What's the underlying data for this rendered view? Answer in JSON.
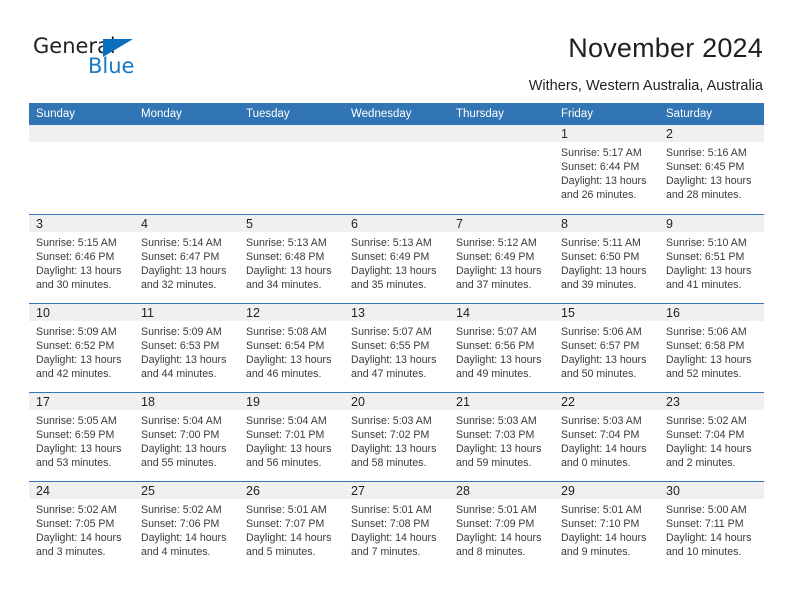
{
  "logo": {
    "word_top": "General",
    "word_bottom": "Blue",
    "triangle_color": "#0b6fc0",
    "blue_text_color": "#1878c4"
  },
  "header": {
    "title": "November 2024",
    "subtitle": "Withers, Western Australia, Australia"
  },
  "colors": {
    "header_blue": "#3175b4",
    "day_band_gray": "#f0f0f0",
    "text": "#231f20"
  },
  "calendar": {
    "weekday_headers": [
      "Sunday",
      "Monday",
      "Tuesday",
      "Wednesday",
      "Thursday",
      "Friday",
      "Saturday"
    ],
    "weeks": [
      [
        {
          "day": "",
          "sunrise": "",
          "sunset": "",
          "daylight_line1": "",
          "daylight_line2": "",
          "empty": true
        },
        {
          "day": "",
          "sunrise": "",
          "sunset": "",
          "daylight_line1": "",
          "daylight_line2": "",
          "empty": true
        },
        {
          "day": "",
          "sunrise": "",
          "sunset": "",
          "daylight_line1": "",
          "daylight_line2": "",
          "empty": true
        },
        {
          "day": "",
          "sunrise": "",
          "sunset": "",
          "daylight_line1": "",
          "daylight_line2": "",
          "empty": true
        },
        {
          "day": "",
          "sunrise": "",
          "sunset": "",
          "daylight_line1": "",
          "daylight_line2": "",
          "empty": true
        },
        {
          "day": "1",
          "sunrise": "Sunrise: 5:17 AM",
          "sunset": "Sunset: 6:44 PM",
          "daylight_line1": "Daylight: 13 hours",
          "daylight_line2": "and 26 minutes.",
          "empty": false
        },
        {
          "day": "2",
          "sunrise": "Sunrise: 5:16 AM",
          "sunset": "Sunset: 6:45 PM",
          "daylight_line1": "Daylight: 13 hours",
          "daylight_line2": "and 28 minutes.",
          "empty": false
        }
      ],
      [
        {
          "day": "3",
          "sunrise": "Sunrise: 5:15 AM",
          "sunset": "Sunset: 6:46 PM",
          "daylight_line1": "Daylight: 13 hours",
          "daylight_line2": "and 30 minutes.",
          "empty": false
        },
        {
          "day": "4",
          "sunrise": "Sunrise: 5:14 AM",
          "sunset": "Sunset: 6:47 PM",
          "daylight_line1": "Daylight: 13 hours",
          "daylight_line2": "and 32 minutes.",
          "empty": false
        },
        {
          "day": "5",
          "sunrise": "Sunrise: 5:13 AM",
          "sunset": "Sunset: 6:48 PM",
          "daylight_line1": "Daylight: 13 hours",
          "daylight_line2": "and 34 minutes.",
          "empty": false
        },
        {
          "day": "6",
          "sunrise": "Sunrise: 5:13 AM",
          "sunset": "Sunset: 6:49 PM",
          "daylight_line1": "Daylight: 13 hours",
          "daylight_line2": "and 35 minutes.",
          "empty": false
        },
        {
          "day": "7",
          "sunrise": "Sunrise: 5:12 AM",
          "sunset": "Sunset: 6:49 PM",
          "daylight_line1": "Daylight: 13 hours",
          "daylight_line2": "and 37 minutes.",
          "empty": false
        },
        {
          "day": "8",
          "sunrise": "Sunrise: 5:11 AM",
          "sunset": "Sunset: 6:50 PM",
          "daylight_line1": "Daylight: 13 hours",
          "daylight_line2": "and 39 minutes.",
          "empty": false
        },
        {
          "day": "9",
          "sunrise": "Sunrise: 5:10 AM",
          "sunset": "Sunset: 6:51 PM",
          "daylight_line1": "Daylight: 13 hours",
          "daylight_line2": "and 41 minutes.",
          "empty": false
        }
      ],
      [
        {
          "day": "10",
          "sunrise": "Sunrise: 5:09 AM",
          "sunset": "Sunset: 6:52 PM",
          "daylight_line1": "Daylight: 13 hours",
          "daylight_line2": "and 42 minutes.",
          "empty": false
        },
        {
          "day": "11",
          "sunrise": "Sunrise: 5:09 AM",
          "sunset": "Sunset: 6:53 PM",
          "daylight_line1": "Daylight: 13 hours",
          "daylight_line2": "and 44 minutes.",
          "empty": false
        },
        {
          "day": "12",
          "sunrise": "Sunrise: 5:08 AM",
          "sunset": "Sunset: 6:54 PM",
          "daylight_line1": "Daylight: 13 hours",
          "daylight_line2": "and 46 minutes.",
          "empty": false
        },
        {
          "day": "13",
          "sunrise": "Sunrise: 5:07 AM",
          "sunset": "Sunset: 6:55 PM",
          "daylight_line1": "Daylight: 13 hours",
          "daylight_line2": "and 47 minutes.",
          "empty": false
        },
        {
          "day": "14",
          "sunrise": "Sunrise: 5:07 AM",
          "sunset": "Sunset: 6:56 PM",
          "daylight_line1": "Daylight: 13 hours",
          "daylight_line2": "and 49 minutes.",
          "empty": false
        },
        {
          "day": "15",
          "sunrise": "Sunrise: 5:06 AM",
          "sunset": "Sunset: 6:57 PM",
          "daylight_line1": "Daylight: 13 hours",
          "daylight_line2": "and 50 minutes.",
          "empty": false
        },
        {
          "day": "16",
          "sunrise": "Sunrise: 5:06 AM",
          "sunset": "Sunset: 6:58 PM",
          "daylight_line1": "Daylight: 13 hours",
          "daylight_line2": "and 52 minutes.",
          "empty": false
        }
      ],
      [
        {
          "day": "17",
          "sunrise": "Sunrise: 5:05 AM",
          "sunset": "Sunset: 6:59 PM",
          "daylight_line1": "Daylight: 13 hours",
          "daylight_line2": "and 53 minutes.",
          "empty": false
        },
        {
          "day": "18",
          "sunrise": "Sunrise: 5:04 AM",
          "sunset": "Sunset: 7:00 PM",
          "daylight_line1": "Daylight: 13 hours",
          "daylight_line2": "and 55 minutes.",
          "empty": false
        },
        {
          "day": "19",
          "sunrise": "Sunrise: 5:04 AM",
          "sunset": "Sunset: 7:01 PM",
          "daylight_line1": "Daylight: 13 hours",
          "daylight_line2": "and 56 minutes.",
          "empty": false
        },
        {
          "day": "20",
          "sunrise": "Sunrise: 5:03 AM",
          "sunset": "Sunset: 7:02 PM",
          "daylight_line1": "Daylight: 13 hours",
          "daylight_line2": "and 58 minutes.",
          "empty": false
        },
        {
          "day": "21",
          "sunrise": "Sunrise: 5:03 AM",
          "sunset": "Sunset: 7:03 PM",
          "daylight_line1": "Daylight: 13 hours",
          "daylight_line2": "and 59 minutes.",
          "empty": false
        },
        {
          "day": "22",
          "sunrise": "Sunrise: 5:03 AM",
          "sunset": "Sunset: 7:04 PM",
          "daylight_line1": "Daylight: 14 hours",
          "daylight_line2": "and 0 minutes.",
          "empty": false
        },
        {
          "day": "23",
          "sunrise": "Sunrise: 5:02 AM",
          "sunset": "Sunset: 7:04 PM",
          "daylight_line1": "Daylight: 14 hours",
          "daylight_line2": "and 2 minutes.",
          "empty": false
        }
      ],
      [
        {
          "day": "24",
          "sunrise": "Sunrise: 5:02 AM",
          "sunset": "Sunset: 7:05 PM",
          "daylight_line1": "Daylight: 14 hours",
          "daylight_line2": "and 3 minutes.",
          "empty": false
        },
        {
          "day": "25",
          "sunrise": "Sunrise: 5:02 AM",
          "sunset": "Sunset: 7:06 PM",
          "daylight_line1": "Daylight: 14 hours",
          "daylight_line2": "and 4 minutes.",
          "empty": false
        },
        {
          "day": "26",
          "sunrise": "Sunrise: 5:01 AM",
          "sunset": "Sunset: 7:07 PM",
          "daylight_line1": "Daylight: 14 hours",
          "daylight_line2": "and 5 minutes.",
          "empty": false
        },
        {
          "day": "27",
          "sunrise": "Sunrise: 5:01 AM",
          "sunset": "Sunset: 7:08 PM",
          "daylight_line1": "Daylight: 14 hours",
          "daylight_line2": "and 7 minutes.",
          "empty": false
        },
        {
          "day": "28",
          "sunrise": "Sunrise: 5:01 AM",
          "sunset": "Sunset: 7:09 PM",
          "daylight_line1": "Daylight: 14 hours",
          "daylight_line2": "and 8 minutes.",
          "empty": false
        },
        {
          "day": "29",
          "sunrise": "Sunrise: 5:01 AM",
          "sunset": "Sunset: 7:10 PM",
          "daylight_line1": "Daylight: 14 hours",
          "daylight_line2": "and 9 minutes.",
          "empty": false
        },
        {
          "day": "30",
          "sunrise": "Sunrise: 5:00 AM",
          "sunset": "Sunset: 7:11 PM",
          "daylight_line1": "Daylight: 14 hours",
          "daylight_line2": "and 10 minutes.",
          "empty": false
        }
      ]
    ]
  }
}
